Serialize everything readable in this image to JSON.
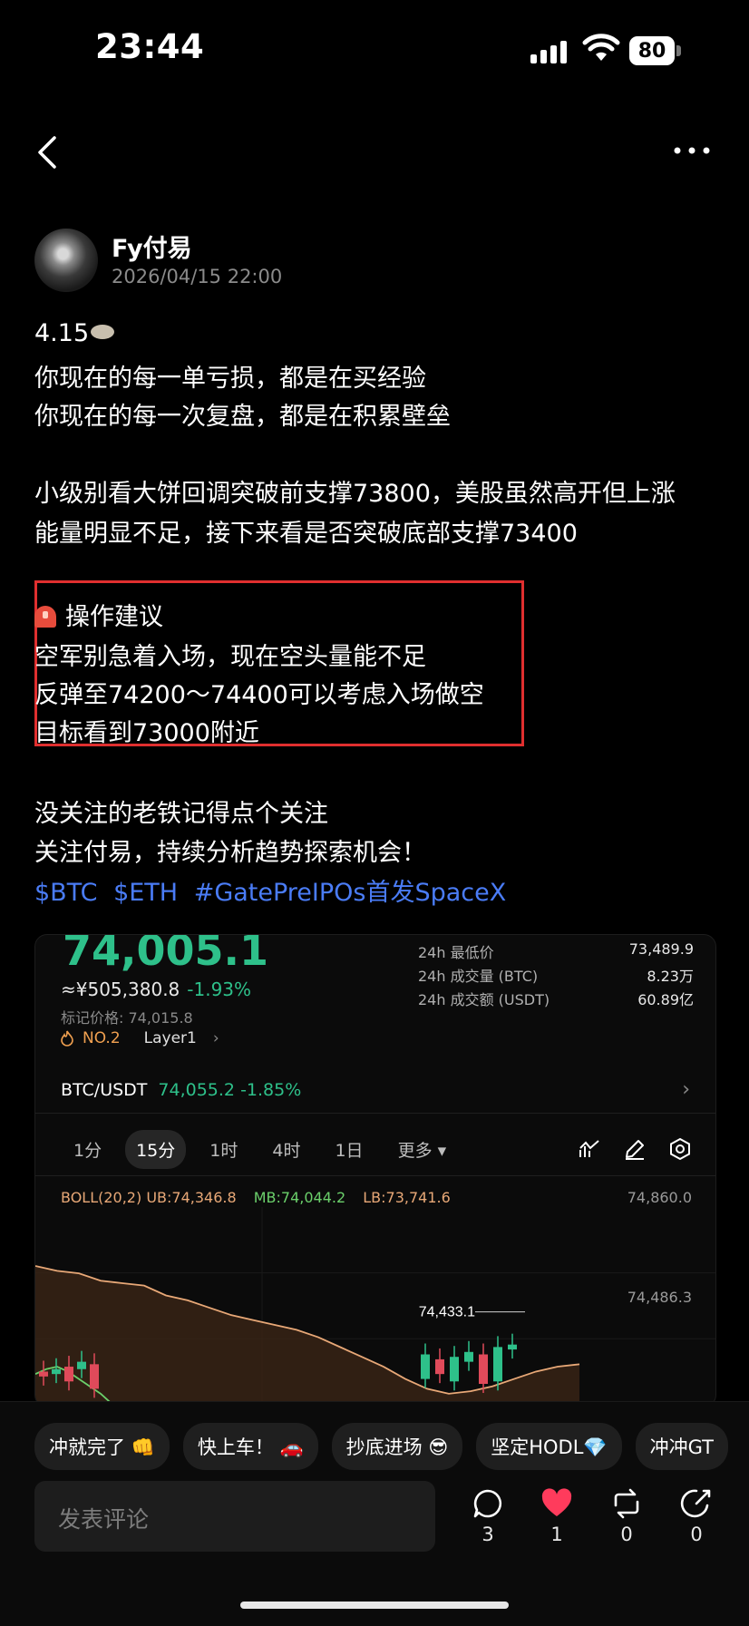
{
  "status_bar": {
    "time": "23:44",
    "battery": "80"
  },
  "icons": {
    "back": "back-chevron-icon",
    "more": "more-dots-icon",
    "siren": "siren-icon"
  },
  "post": {
    "author": "Fy付易",
    "timestamp": "2026/04/15 22:00",
    "date_line": "4.15",
    "lines": [
      "你现在的每一单亏损，都是在买经验",
      "你现在的每一次复盘，都是在积累壁垒",
      "小级别看大饼回调突破前支撑73800，美股虽然高开但上涨",
      "能量明显不足，接下来看是否突破底部支撑73400"
    ],
    "advice_title": "操作建议",
    "advice_lines": [
      "空军别急着入场，现在空头量能不足",
      "反弹至74200～74400可以考虑入场做空",
      "目标看到73000附近"
    ],
    "closing_lines": [
      "没关注的老铁记得点个关注",
      "关注付易，持续分析趋势探索机会！"
    ],
    "tags": [
      "$BTC",
      "$ETH",
      "#GatePreIPOs首发SpaceX"
    ]
  },
  "market_card": {
    "price": "74,005.1",
    "cny_price": "≈¥505,380.8",
    "change": "-1.93%",
    "mark_price": "标记价格: 74,015.8",
    "rank": "NO.2",
    "category": "Layer1",
    "stats": [
      {
        "label": "24h 最低价",
        "value": "73,489.9"
      },
      {
        "label": "24h 成交量 (BTC)",
        "value": "8.23万"
      },
      {
        "label": "24h 成交额 (USDT)",
        "value": "60.89亿"
      }
    ],
    "pair": "BTC/USDT",
    "pair_price": "74,055.2",
    "pair_change": "-1.85%",
    "timeframes": [
      "1分",
      "15分",
      "1时",
      "4时",
      "1日",
      "更多"
    ],
    "active_timeframe": "15分",
    "boll": {
      "params": "BOLL(20,2)",
      "ub": "UB:74,346.8",
      "mb": "MB:74,044.2",
      "lb": "LB:73,741.6"
    },
    "y_labels": [
      "74,860.0",
      "74,486.3"
    ],
    "high_marker": "74,433.1"
  },
  "chart_data": {
    "type": "line",
    "series": [
      {
        "name": "UB",
        "x": [
          0,
          1,
          2,
          3,
          4,
          5,
          6,
          7,
          8,
          9,
          10,
          11,
          12,
          13,
          14,
          15,
          16,
          17,
          18,
          19,
          20,
          21,
          22,
          23,
          24,
          25
        ],
        "values": [
          74620,
          74600,
          74590,
          74560,
          74550,
          74540,
          74500,
          74480,
          74450,
          74420,
          74400,
          74380,
          74360,
          74330,
          74290,
          74250,
          74210,
          74160,
          74120,
          74100,
          74110,
          74130,
          74160,
          74190,
          74210,
          74220
        ]
      },
      {
        "name": "MB",
        "x": [
          0,
          1,
          2,
          3,
          4,
          5,
          6,
          7,
          8,
          9,
          10,
          11,
          12,
          13,
          14
        ],
        "values": [
          74180,
          74200,
          74210,
          74190,
          74160,
          74130,
          74100,
          74060,
          74020,
          73990,
          73960,
          73930,
          73900,
          73880,
          73860
        ]
      }
    ],
    "candles": [
      {
        "o": 74190,
        "c": 74170,
        "up": false
      },
      {
        "o": 74180,
        "c": 74200,
        "up": true
      },
      {
        "o": 74210,
        "c": 74150,
        "up": false
      },
      {
        "o": 74200,
        "c": 74230,
        "up": true
      },
      {
        "o": 74220,
        "c": 74120,
        "up": false
      },
      {
        "o": 74160,
        "c": 74260,
        "up": true
      },
      {
        "o": 74240,
        "c": 74180,
        "up": false
      },
      {
        "o": 74150,
        "c": 74250,
        "up": true
      },
      {
        "o": 74230,
        "c": 74270,
        "up": true
      },
      {
        "o": 74260,
        "c": 74140,
        "up": false
      },
      {
        "o": 74150,
        "c": 74290,
        "up": true
      },
      {
        "o": 74280,
        "c": 74300,
        "up": true
      }
    ],
    "ylim": [
      73900,
      74860
    ]
  },
  "reactions": [
    "冲就完了 👊",
    "快上车！ 🚗",
    "抄底进场 😎",
    "坚定HODL💎",
    "冲冲GT"
  ],
  "comment_placeholder": "发表评论",
  "actions": [
    {
      "icon": "comment-icon",
      "count": "3"
    },
    {
      "icon": "heart-icon",
      "count": "1"
    },
    {
      "icon": "repost-icon",
      "count": "0"
    },
    {
      "icon": "share-icon",
      "count": "0"
    }
  ]
}
